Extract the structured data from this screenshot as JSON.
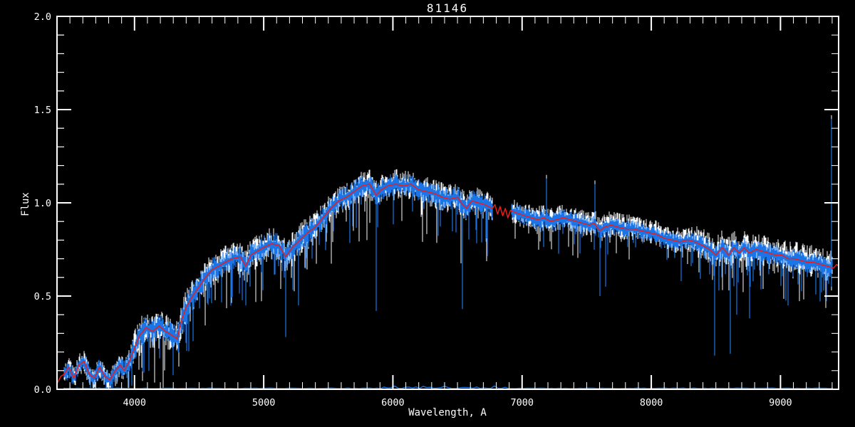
{
  "window": {
    "background_color": "#000000"
  },
  "chart_data": {
    "type": "line",
    "title": "81146",
    "xlabel": "Wavelength, A",
    "ylabel": "Flux",
    "x_range": [
      3400,
      9450
    ],
    "y_range": [
      0.0,
      2.0
    ],
    "x_ticks": [
      {
        "value": 4000,
        "label": "4000"
      },
      {
        "value": 5000,
        "label": "5000"
      },
      {
        "value": 6000,
        "label": "6000"
      },
      {
        "value": 7000,
        "label": "7000"
      },
      {
        "value": 8000,
        "label": "8000"
      },
      {
        "value": 9000,
        "label": "9000"
      }
    ],
    "y_ticks": [
      {
        "value": 0.0,
        "label": "0.0"
      },
      {
        "value": 0.5,
        "label": "0.5"
      },
      {
        "value": 1.0,
        "label": "1.0"
      },
      {
        "value": 1.5,
        "label": "1.5"
      },
      {
        "value": 2.0,
        "label": "2.0"
      }
    ],
    "x_minor_step": 100,
    "y_minor_step": 0.1,
    "grid": false,
    "legend": "none",
    "colors": {
      "background": "#000000",
      "frame": "#ffffff",
      "observed_white": "#ffffff",
      "observed_blue": "#1b75e6",
      "model_red": "#e81e1e"
    },
    "gap_region": [
      6775,
      6918
    ],
    "spectrum_span": [
      3450,
      9405
    ],
    "zero_line": {
      "level": 0.004,
      "from": 3450,
      "to": 9405
    },
    "series": [
      {
        "name": "observed spectrum (white, noisy)",
        "color": "#ffffff",
        "render": "noise-band"
      },
      {
        "name": "observed spectrum (blue, noisy, overlaid)",
        "color": "#1b75e6",
        "render": "noise-band"
      },
      {
        "name": "smooth model fit (red)",
        "color": "#e81e1e",
        "render": "line",
        "points": [
          [
            3400,
            0.03
          ],
          [
            3430,
            0.07
          ],
          [
            3455,
            0.08
          ],
          [
            3490,
            0.12
          ],
          [
            3530,
            0.06
          ],
          [
            3570,
            0.13
          ],
          [
            3610,
            0.15
          ],
          [
            3650,
            0.08
          ],
          [
            3690,
            0.06
          ],
          [
            3730,
            0.12
          ],
          [
            3770,
            0.07
          ],
          [
            3810,
            0.05
          ],
          [
            3850,
            0.1
          ],
          [
            3890,
            0.13
          ],
          [
            3920,
            0.1
          ],
          [
            3960,
            0.15
          ],
          [
            4000,
            0.22
          ],
          [
            4040,
            0.29
          ],
          [
            4090,
            0.33
          ],
          [
            4140,
            0.31
          ],
          [
            4190,
            0.34
          ],
          [
            4240,
            0.31
          ],
          [
            4290,
            0.29
          ],
          [
            4330,
            0.27
          ],
          [
            4360,
            0.36
          ],
          [
            4400,
            0.44
          ],
          [
            4450,
            0.5
          ],
          [
            4500,
            0.55
          ],
          [
            4550,
            0.6
          ],
          [
            4600,
            0.64
          ],
          [
            4650,
            0.66
          ],
          [
            4700,
            0.68
          ],
          [
            4760,
            0.7
          ],
          [
            4820,
            0.71
          ],
          [
            4861,
            0.66
          ],
          [
            4900,
            0.72
          ],
          [
            4950,
            0.74
          ],
          [
            5000,
            0.76
          ],
          [
            5060,
            0.78
          ],
          [
            5120,
            0.77
          ],
          [
            5170,
            0.71
          ],
          [
            5220,
            0.76
          ],
          [
            5280,
            0.8
          ],
          [
            5340,
            0.84
          ],
          [
            5400,
            0.87
          ],
          [
            5460,
            0.92
          ],
          [
            5520,
            0.97
          ],
          [
            5580,
            1.01
          ],
          [
            5640,
            1.03
          ],
          [
            5700,
            1.06
          ],
          [
            5760,
            1.09
          ],
          [
            5820,
            1.1
          ],
          [
            5870,
            1.04
          ],
          [
            5910,
            1.07
          ],
          [
            5960,
            1.09
          ],
          [
            6020,
            1.1
          ],
          [
            6080,
            1.09
          ],
          [
            6140,
            1.1
          ],
          [
            6200,
            1.07
          ],
          [
            6260,
            1.06
          ],
          [
            6320,
            1.05
          ],
          [
            6380,
            1.03
          ],
          [
            6440,
            1.02
          ],
          [
            6500,
            1.03
          ],
          [
            6540,
            0.99
          ],
          [
            6570,
            0.97
          ],
          [
            6610,
            1.01
          ],
          [
            6660,
            1.0
          ],
          [
            6710,
            0.99
          ],
          [
            6770,
            0.97
          ],
          [
            6790,
            0.99
          ],
          [
            6810,
            0.94
          ],
          [
            6830,
            0.98
          ],
          [
            6850,
            0.93
          ],
          [
            6870,
            0.97
          ],
          [
            6890,
            0.92
          ],
          [
            6910,
            0.96
          ],
          [
            6940,
            0.95
          ],
          [
            6980,
            0.94
          ],
          [
            7020,
            0.93
          ],
          [
            7070,
            0.92
          ],
          [
            7120,
            0.91
          ],
          [
            7170,
            0.92
          ],
          [
            7220,
            0.9
          ],
          [
            7270,
            0.91
          ],
          [
            7320,
            0.92
          ],
          [
            7370,
            0.91
          ],
          [
            7420,
            0.9
          ],
          [
            7470,
            0.89
          ],
          [
            7520,
            0.88
          ],
          [
            7560,
            0.89
          ],
          [
            7600,
            0.85
          ],
          [
            7640,
            0.87
          ],
          [
            7690,
            0.88
          ],
          [
            7740,
            0.87
          ],
          [
            7800,
            0.86
          ],
          [
            7860,
            0.86
          ],
          [
            7920,
            0.85
          ],
          [
            7980,
            0.84
          ],
          [
            8040,
            0.83
          ],
          [
            8100,
            0.81
          ],
          [
            8160,
            0.8
          ],
          [
            8220,
            0.79
          ],
          [
            8280,
            0.8
          ],
          [
            8340,
            0.79
          ],
          [
            8400,
            0.77
          ],
          [
            8450,
            0.75
          ],
          [
            8500,
            0.72
          ],
          [
            8550,
            0.76
          ],
          [
            8600,
            0.72
          ],
          [
            8640,
            0.76
          ],
          [
            8680,
            0.73
          ],
          [
            8720,
            0.76
          ],
          [
            8760,
            0.73
          ],
          [
            8810,
            0.75
          ],
          [
            8860,
            0.74
          ],
          [
            8910,
            0.73
          ],
          [
            8960,
            0.72
          ],
          [
            9010,
            0.72
          ],
          [
            9060,
            0.7
          ],
          [
            9110,
            0.7
          ],
          [
            9160,
            0.69
          ],
          [
            9210,
            0.68
          ],
          [
            9260,
            0.68
          ],
          [
            9310,
            0.67
          ],
          [
            9360,
            0.66
          ],
          [
            9410,
            0.65
          ],
          [
            9435,
            0.67
          ],
          [
            9450,
            0.66
          ]
        ]
      },
      {
        "name": "zero / sky level (blue)",
        "color": "#1b75e6",
        "render": "flat",
        "level": 0.004
      }
    ],
    "noise_regions": [
      {
        "from": 3450,
        "to": 3950,
        "blue": 0.04,
        "white": 0.055,
        "white_bias": 0.005,
        "forest": 0.06,
        "forest_p": 0.2
      },
      {
        "from": 3950,
        "to": 4500,
        "blue": 0.06,
        "white": 0.085,
        "white_bias": 0.01,
        "forest": 0.24,
        "forest_p": 0.25
      },
      {
        "from": 4500,
        "to": 5450,
        "blue": 0.055,
        "white": 0.08,
        "white_bias": 0.01,
        "forest": 0.2,
        "forest_p": 0.2
      },
      {
        "from": 5450,
        "to": 6775,
        "blue": 0.05,
        "white": 0.07,
        "white_bias": 0.012,
        "forest": 0.26,
        "forest_p": 0.18
      },
      {
        "from": 6918,
        "to": 7500,
        "blue": 0.04,
        "white": 0.06,
        "white_bias": 0.012,
        "forest": 0.14,
        "forest_p": 0.15
      },
      {
        "from": 7500,
        "to": 8350,
        "blue": 0.035,
        "white": 0.055,
        "white_bias": 0.022,
        "forest": 0.12,
        "forest_p": 0.12
      },
      {
        "from": 8350,
        "to": 9405,
        "blue": 0.045,
        "white": 0.07,
        "white_bias": 0.025,
        "forest": 0.18,
        "forest_p": 0.2
      }
    ],
    "absorption_lines": [
      {
        "wavelength": 4330,
        "floor": 0.25
      },
      {
        "wavelength": 4861,
        "floor": 0.45
      },
      {
        "wavelength": 5168,
        "floor": 0.28
      },
      {
        "wavelength": 5270,
        "floor": 0.45
      },
      {
        "wavelength": 5868,
        "floor": 0.42
      },
      {
        "wavelength": 6540,
        "floor": 0.43
      },
      {
        "wavelength": 7600,
        "floor": 0.5
      },
      {
        "wavelength": 7645,
        "floor": 0.55
      },
      {
        "wavelength": 8230,
        "floor": 0.58
      },
      {
        "wavelength": 8490,
        "floor": 0.18
      },
      {
        "wavelength": 8612,
        "floor": 0.19
      },
      {
        "wavelength": 8662,
        "floor": 0.4
      },
      {
        "wavelength": 8760,
        "floor": 0.38
      },
      {
        "wavelength": 9060,
        "floor": 0.45
      },
      {
        "wavelength": 9320,
        "floor": 0.52
      }
    ],
    "emission_spikes": [
      {
        "wavelength": 7190,
        "top": 1.13
      },
      {
        "wavelength": 7565,
        "top": 1.1
      },
      {
        "wavelength": 9395,
        "top": 1.45,
        "bottom": 0.53
      }
    ],
    "noise_seed": 42
  }
}
